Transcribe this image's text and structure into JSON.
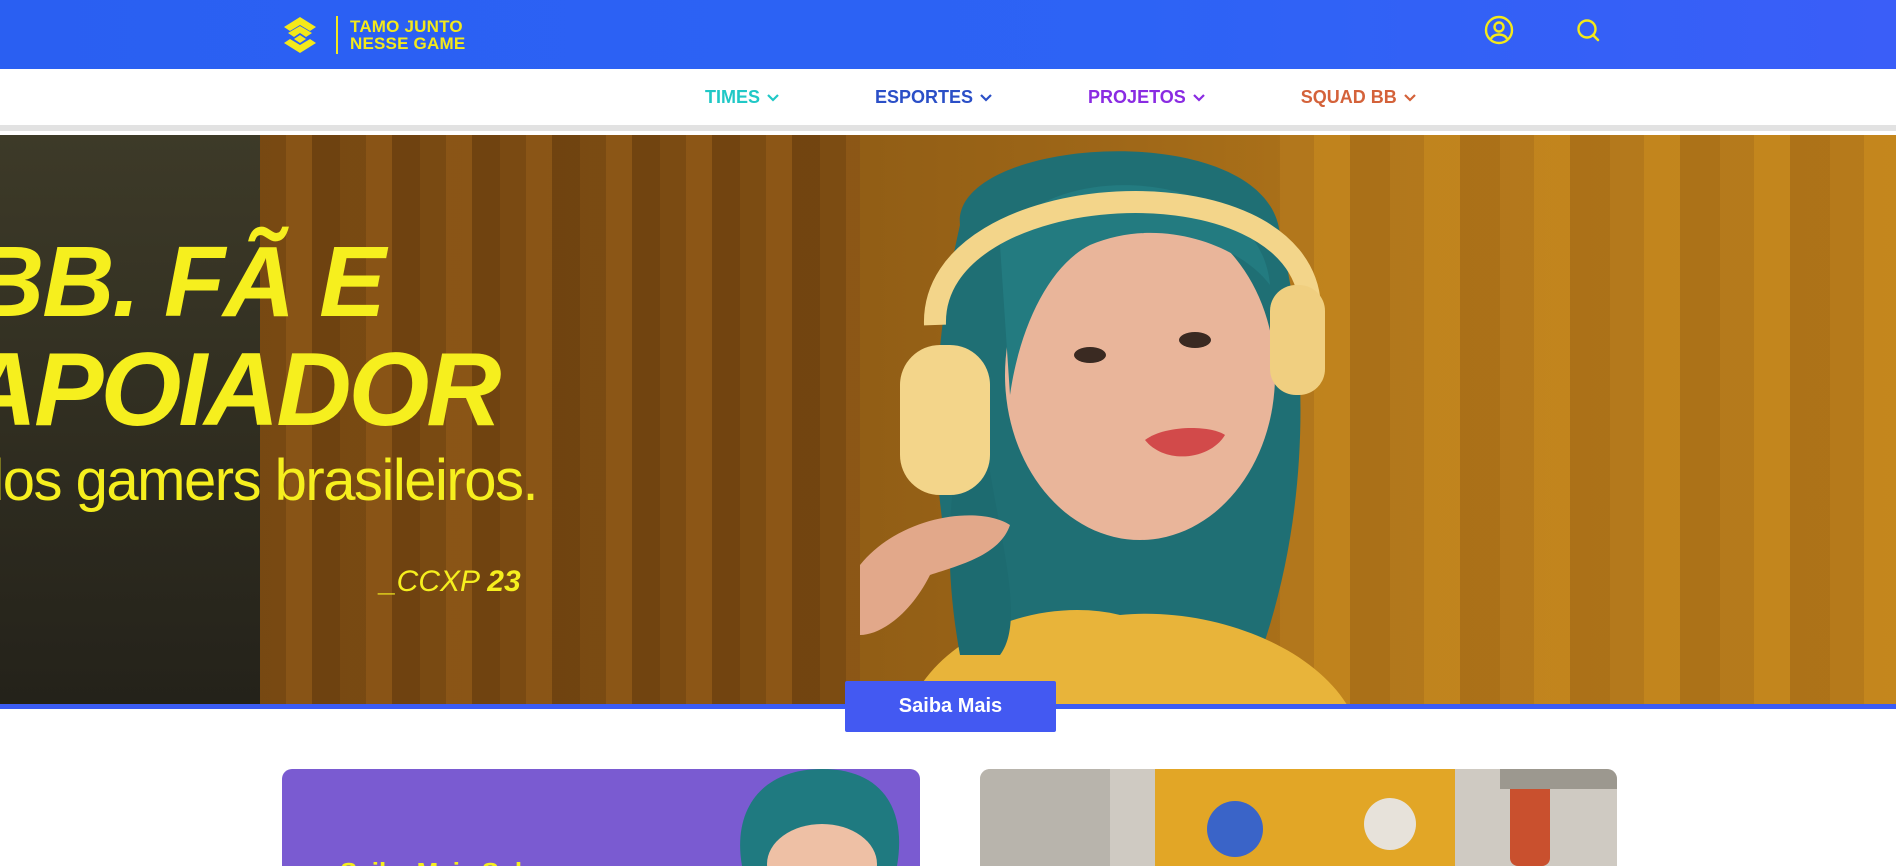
{
  "header": {
    "logo_line1": "TAMO JUNTO",
    "logo_line2": "NESSE GAME",
    "logo_icon": "bb-logo-icon",
    "user_icon": "user-icon",
    "search_icon": "search-icon",
    "brand_color": "#2d63f5",
    "accent_color": "#f4e91a"
  },
  "nav": {
    "items": [
      {
        "label": "TIMES",
        "color": "#20c8c6"
      },
      {
        "label": "ESPORTES",
        "color": "#2b4fc7"
      },
      {
        "label": "PROJETOS",
        "color": "#8a2be2"
      },
      {
        "label": "SQUAD BB",
        "color": "#d4623a"
      }
    ],
    "chevron_icon": "chevron-down-icon"
  },
  "hero": {
    "line1": "BB. FÃ E",
    "line2": "APOIADOR",
    "line3": "dos gamers brasileiros.",
    "tag_prefix": "_CCXP",
    "tag_number": "23",
    "cta_label": "Saiba Mais"
  },
  "cards": {
    "left_title": "Saiba Mais Sobre"
  }
}
